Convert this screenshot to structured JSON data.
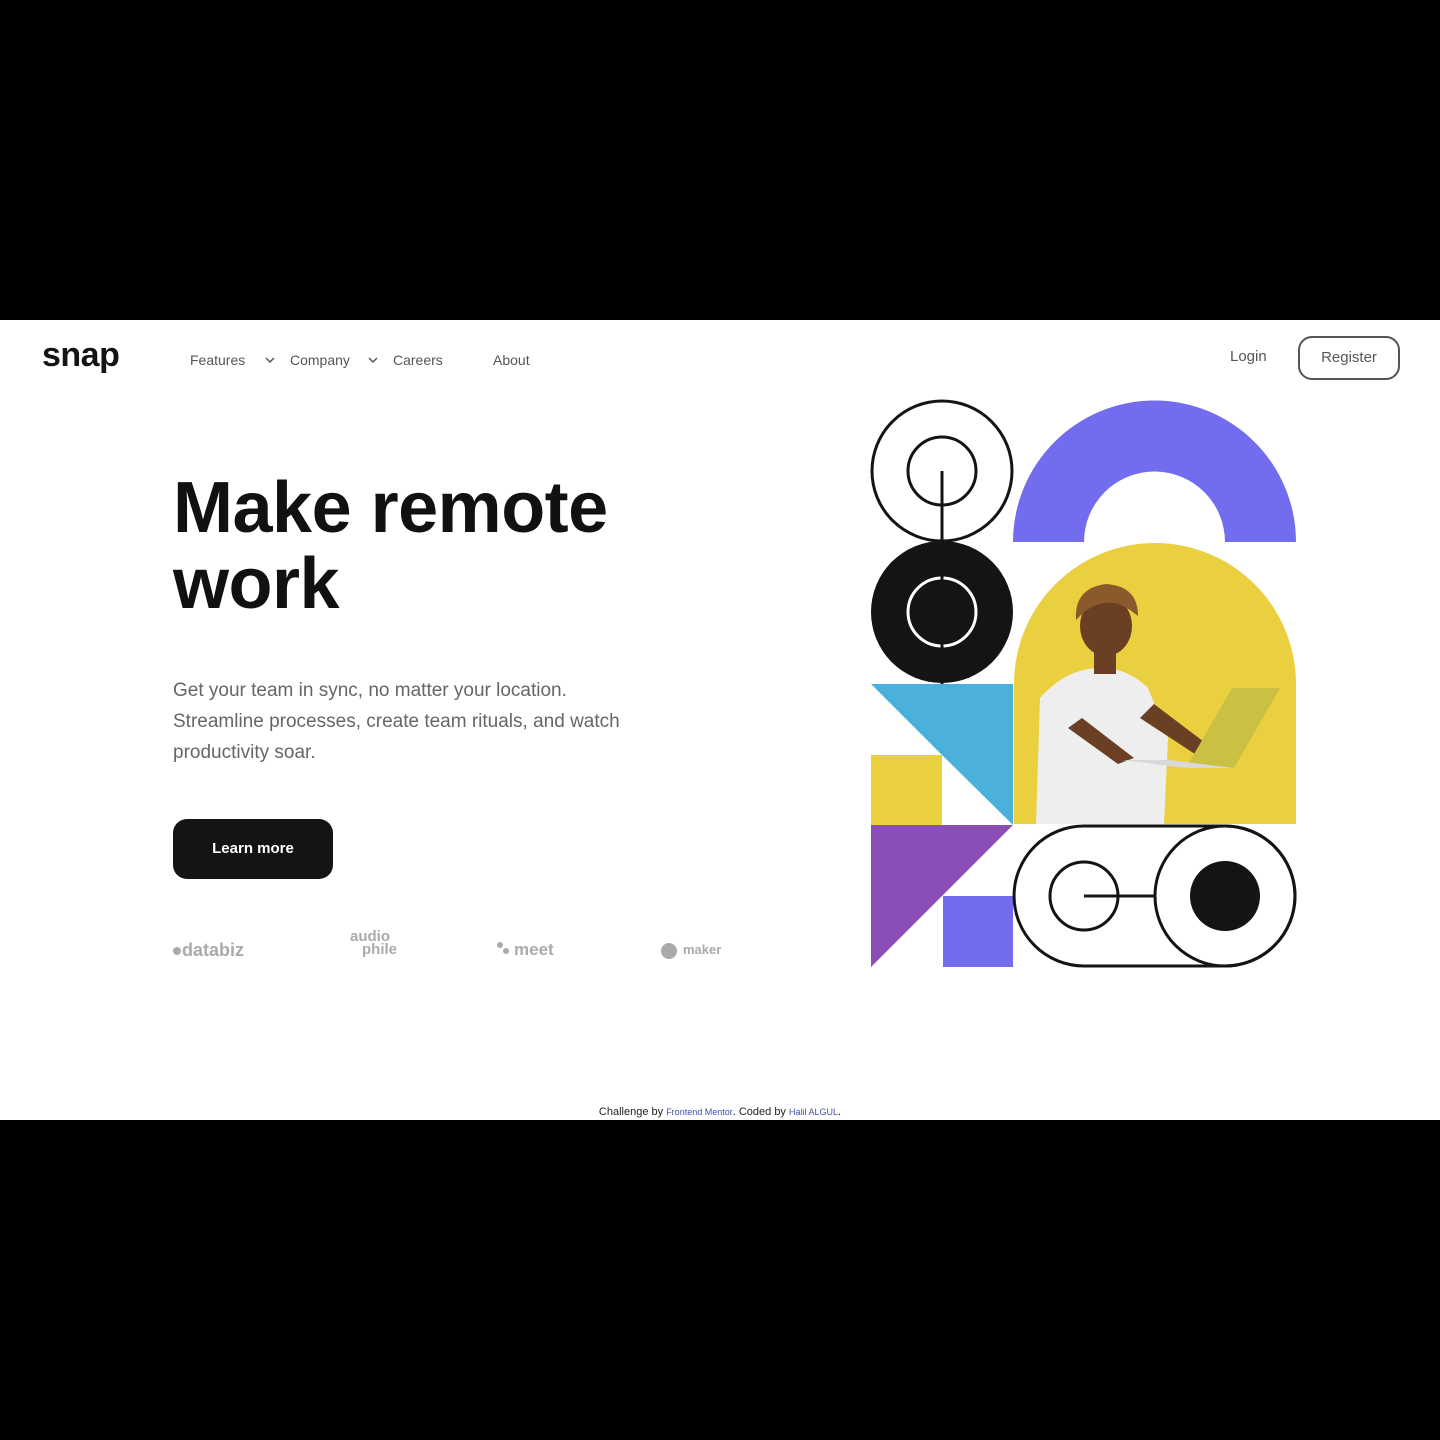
{
  "brand": {
    "logo_text": "snap"
  },
  "nav": {
    "items": [
      {
        "label": "Features",
        "has_dropdown": true
      },
      {
        "label": "Company",
        "has_dropdown": true
      },
      {
        "label": "Careers",
        "has_dropdown": false
      },
      {
        "label": "About",
        "has_dropdown": false
      }
    ],
    "login_label": "Login",
    "register_label": "Register"
  },
  "hero": {
    "title_line1": "Make remote",
    "title_line2": "work",
    "description": "Get your team in sync, no matter your location. Streamline processes, create team rituals, and watch productivity soar.",
    "cta_label": "Learn more"
  },
  "clients": [
    {
      "name": "databiz"
    },
    {
      "name": "audio",
      "name2": "phile"
    },
    {
      "name": "meet"
    },
    {
      "name": "maker"
    }
  ],
  "footer": {
    "prefix": "Challenge by ",
    "link1": "Frontend Mentor",
    "middle": ". Coded by ",
    "link2": "Halil ALGUL",
    "suffix": "."
  },
  "colors": {
    "accent_purple": "#726cee",
    "yellow": "#eacf3e",
    "blue": "#4bb1db",
    "violet": "#8b4eb6",
    "dark": "#141414"
  },
  "icons": [
    "chevron-down-icon"
  ]
}
